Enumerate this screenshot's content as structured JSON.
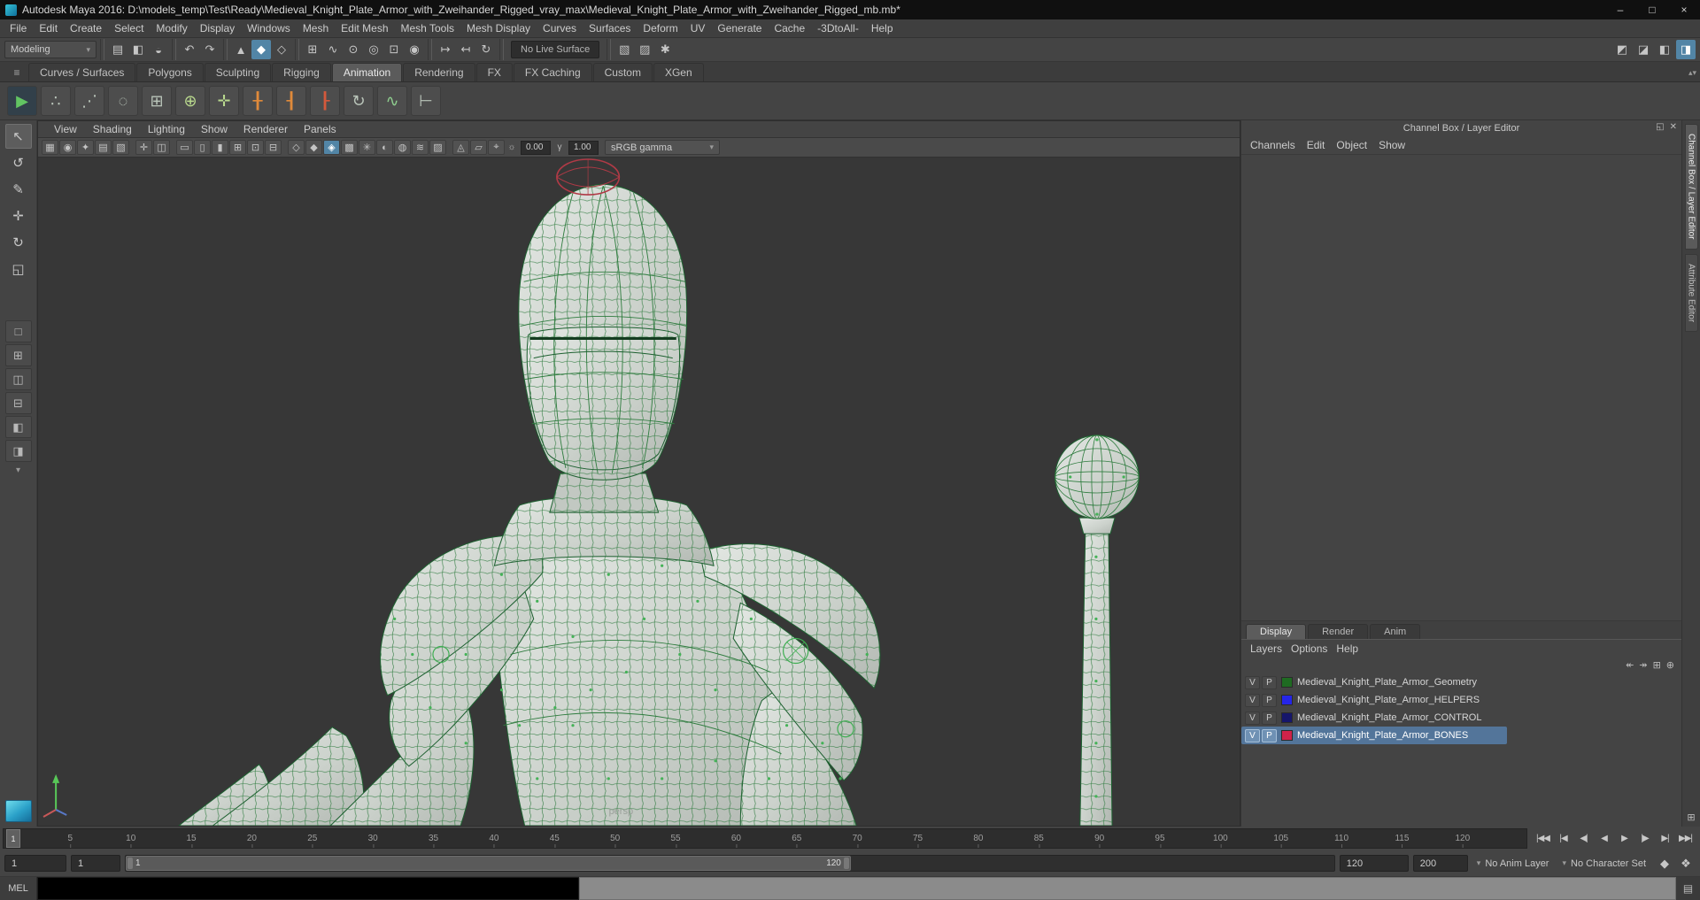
{
  "window": {
    "title": "Autodesk Maya 2016: D:\\models_temp\\Test\\Ready\\Medieval_Knight_Plate_Armor_with_Zweihander_Rigged_vray_max\\Medieval_Knight_Plate_Armor_with_Zweihander_Rigged_mb.mb*",
    "controls": [
      {
        "name": "minimize-button",
        "glyph": "–"
      },
      {
        "name": "maximize-button",
        "glyph": "□"
      },
      {
        "name": "close-button",
        "glyph": "×"
      }
    ]
  },
  "icons": {
    "caret_down": "▾",
    "shelf_menu": "≡",
    "shelf_scroll": "▴▾",
    "toolbox_more": "▾"
  },
  "menubar": {
    "items": [
      "File",
      "Edit",
      "Create",
      "Select",
      "Modify",
      "Display",
      "Windows",
      "Mesh",
      "Edit Mesh",
      "Mesh Tools",
      "Mesh Display",
      "Curves",
      "Surfaces",
      "Deform",
      "UV",
      "Generate",
      "Cache",
      "-3DtoAll-",
      "Help"
    ]
  },
  "statusline": {
    "menuset": "Modeling",
    "live_surface": "No Live Surface",
    "sections": [
      {
        "type": "icons",
        "icons": [
          {
            "name": "new-scene-icon",
            "glyph": "▤"
          },
          {
            "name": "open-scene-icon",
            "glyph": "◧"
          },
          {
            "name": "save-scene-icon",
            "glyph": "◒"
          }
        ]
      },
      {
        "type": "icons",
        "icons": [
          {
            "name": "undo-icon",
            "glyph": "↶"
          },
          {
            "name": "redo-icon",
            "glyph": "↷"
          }
        ]
      },
      {
        "type": "icons",
        "icons": [
          {
            "name": "select-hierarchy-icon",
            "glyph": "▲"
          },
          {
            "name": "select-object-icon",
            "glyph": "◆",
            "active": true
          },
          {
            "name": "select-component-icon",
            "glyph": "◇"
          }
        ]
      },
      {
        "type": "icons",
        "icons": [
          {
            "name": "snap-grid-icon",
            "glyph": "⊞"
          },
          {
            "name": "snap-curve-icon",
            "glyph": "∿"
          },
          {
            "name": "snap-point-icon",
            "glyph": "⊙"
          },
          {
            "name": "snap-projected-center-icon",
            "glyph": "◎"
          },
          {
            "name": "snap-view-plane-icon",
            "glyph": "⊡"
          },
          {
            "name": "make-live-icon",
            "glyph": "◉"
          }
        ]
      },
      {
        "type": "icons",
        "icons": [
          {
            "name": "input-connections-icon",
            "glyph": "↦"
          },
          {
            "name": "output-connections-icon",
            "glyph": "↤"
          },
          {
            "name": "construction-history-icon",
            "glyph": "↻"
          }
        ]
      },
      {
        "type": "field"
      },
      {
        "type": "icons",
        "icons": [
          {
            "name": "render-view-icon",
            "glyph": "▧"
          },
          {
            "name": "ipr-render-icon",
            "glyph": "▨"
          },
          {
            "name": "render-settings-icon",
            "glyph": "✱"
          }
        ]
      }
    ],
    "right_icons": [
      {
        "name": "sidebar-modeling-toolkit-icon",
        "glyph": "◩"
      },
      {
        "name": "sidebar-attribute-editor-icon",
        "glyph": "◪"
      },
      {
        "name": "sidebar-tool-settings-icon",
        "glyph": "◧"
      },
      {
        "name": "sidebar-channel-box-icon",
        "glyph": "◨",
        "active": true
      }
    ]
  },
  "shelf": {
    "tabs": [
      "Curves / Surfaces",
      "Polygons",
      "Sculpting",
      "Rigging",
      "Animation",
      "Rendering",
      "FX",
      "FX Caching",
      "Custom",
      "XGen"
    ],
    "active_tab": "Animation",
    "icons": [
      {
        "name": "playblast-icon",
        "glyph": "▶",
        "fg": "#62c462",
        "bg": "#32404a"
      },
      {
        "name": "set-key-icon",
        "glyph": "∴",
        "fg": "#b9c4b9",
        "bg": "#4d4d4d"
      },
      {
        "name": "set-breakdown-icon",
        "glyph": "⋰",
        "fg": "#b9c4b9",
        "bg": "#4d4d4d"
      },
      {
        "name": "motion-trail-icon",
        "glyph": "◌",
        "fg": "#b9c4b9",
        "bg": "#4d4d4d"
      },
      {
        "name": "ghost-icon",
        "glyph": "⊞",
        "fg": "#b9c4b9",
        "bg": "#4d4d4d"
      },
      {
        "name": "create-character-set-icon",
        "glyph": "⊕",
        "fg": "#b9d98e",
        "bg": "#4d4d4d"
      },
      {
        "name": "add-to-character-set-icon",
        "glyph": "✛",
        "fg": "#b9d98e",
        "bg": "#4d4d4d"
      },
      {
        "name": "point-constraint-icon",
        "glyph": "╂",
        "fg": "#e08a3a",
        "bg": "#4d4d4d"
      },
      {
        "name": "aim-constraint-icon",
        "glyph": "┨",
        "fg": "#e08a3a",
        "bg": "#4d4d4d"
      },
      {
        "name": "orient-constraint-icon",
        "glyph": "┠",
        "fg": "#d4593c",
        "bg": "#4d4d4d"
      },
      {
        "name": "set-driven-key-icon",
        "glyph": "↻",
        "fg": "#b9c4b9",
        "bg": "#4d4d4d"
      },
      {
        "name": "spline-ik-icon",
        "glyph": "∿",
        "fg": "#8fcf8f",
        "bg": "#4d4d4d"
      },
      {
        "name": "ik-handle-icon",
        "glyph": "⊢",
        "fg": "#b9c4b9",
        "bg": "#4d4d4d"
      }
    ]
  },
  "toolbox": {
    "tools": [
      {
        "name": "select-tool-icon",
        "glyph": "↖",
        "active": true
      },
      {
        "name": "lasso-tool-icon",
        "glyph": "↺"
      },
      {
        "name": "paint-select-tool-icon",
        "glyph": "✎"
      },
      {
        "name": "move-tool-icon",
        "glyph": "✛"
      },
      {
        "name": "rotate-tool-icon",
        "glyph": "↻"
      },
      {
        "name": "scale-tool-icon",
        "glyph": "◱"
      }
    ],
    "layouts": [
      {
        "name": "layout-single-pane-icon",
        "glyph": "□"
      },
      {
        "name": "layout-four-view-icon",
        "glyph": "⊞"
      },
      {
        "name": "layout-two-side-by-side-icon",
        "glyph": "◫"
      },
      {
        "name": "layout-two-stacked-icon",
        "glyph": "⊟"
      },
      {
        "name": "layout-three-split-icon",
        "glyph": "◧"
      },
      {
        "name": "layout-outliner-persp-icon",
        "glyph": "◨"
      }
    ]
  },
  "viewport": {
    "menus": [
      "View",
      "Shading",
      "Lighting",
      "Show",
      "Renderer",
      "Panels"
    ],
    "toolbar_icons": [
      {
        "name": "select-camera-icon",
        "glyph": "▦"
      },
      {
        "name": "lock-camera-icon",
        "glyph": "◉"
      },
      {
        "name": "camera-attributes-icon",
        "glyph": "✦"
      },
      {
        "name": "bookmarks-icon",
        "glyph": "▤"
      },
      {
        "name": "image-plane-icon",
        "glyph": "▧"
      },
      {
        "name": "two-d-pan-zoom-icon",
        "glyph": "✛"
      },
      {
        "name": "overscan-icon",
        "glyph": "◫"
      },
      {
        "name": "film-gate-icon",
        "glyph": "▭"
      },
      {
        "name": "resolution-gate-icon",
        "glyph": "▯"
      },
      {
        "name": "gate-mask-icon",
        "glyph": "▮"
      },
      {
        "name": "field-chart-icon",
        "glyph": "⊞"
      },
      {
        "name": "safe-action-icon",
        "glyph": "⊡"
      },
      {
        "name": "safe-title-icon",
        "glyph": "⊟"
      },
      {
        "name": "wireframe-icon",
        "glyph": "◇"
      },
      {
        "name": "shaded-icon",
        "glyph": "◆"
      },
      {
        "name": "wireframe-on-shaded-icon",
        "glyph": "◈",
        "active": true
      },
      {
        "name": "textured-icon",
        "glyph": "▩"
      },
      {
        "name": "use-all-lights-icon",
        "glyph": "✳"
      },
      {
        "name": "shadows-icon",
        "glyph": "◐"
      },
      {
        "name": "screen-ao-icon",
        "glyph": "◍"
      },
      {
        "name": "motion-blur-icon",
        "glyph": "≋"
      },
      {
        "name": "multisample-icon",
        "glyph": "▨"
      },
      {
        "name": "isolate-select-icon",
        "glyph": "◬"
      },
      {
        "name": "xray-icon",
        "glyph": "▱"
      },
      {
        "name": "xray-joints-icon",
        "glyph": "⌖"
      }
    ],
    "exposure_icon_glyph": "☼",
    "gamma_icon_glyph": "γ",
    "exposure_label": "0.00",
    "gamma_label": "1.00",
    "view_transform": "sRGB gamma",
    "camera_label": "persp"
  },
  "channel_box": {
    "header": "Channel Box / Layer Editor",
    "header_icons": [
      {
        "name": "float-panel-icon",
        "glyph": "◱"
      },
      {
        "name": "close-panel-icon",
        "glyph": "✕"
      }
    ],
    "menus": [
      "Channels",
      "Edit",
      "Object",
      "Show"
    ]
  },
  "layer_editor": {
    "tabs": [
      {
        "label": "Display",
        "active": true
      },
      {
        "label": "Render",
        "active": false
      },
      {
        "label": "Anim",
        "active": false
      }
    ],
    "menus": [
      "Layers",
      "Options",
      "Help"
    ],
    "toolbar_icons": [
      {
        "name": "move-layer-up-icon",
        "glyph": "↞"
      },
      {
        "name": "move-layer-down-icon",
        "glyph": "↠"
      },
      {
        "name": "new-empty-layer-icon",
        "glyph": "⊞"
      },
      {
        "name": "new-layer-from-selected-icon",
        "glyph": "⊕"
      }
    ],
    "layers": [
      {
        "visible": "V",
        "playback": "P",
        "color": "#1f6b22",
        "name": "Medieval_Knight_Plate_Armor_Geometry",
        "selected": false
      },
      {
        "visible": "V",
        "playback": "P",
        "color": "#2525e8",
        "name": "Medieval_Knight_Plate_Armor_HELPERS",
        "selected": false
      },
      {
        "visible": "V",
        "playback": "P",
        "color": "#16166b",
        "name": "Medieval_Knight_Plate_Armor_CONTROL",
        "selected": false
      },
      {
        "visible": "V",
        "playback": "P",
        "color": "#d0224a",
        "name": "Medieval_Knight_Plate_Armor_BONES",
        "selected": true
      }
    ]
  },
  "sidebar": {
    "tabs": [
      {
        "label": "Channel Box / Layer Editor",
        "active": true
      },
      {
        "label": "Attribute Editor",
        "active": false
      }
    ],
    "bottom_icon": {
      "name": "raise-panel-icon",
      "glyph": "⊞"
    }
  },
  "timeline": {
    "current_frame": "1",
    "ticks": [
      5,
      10,
      15,
      20,
      25,
      30,
      35,
      40,
      45,
      50,
      55,
      60,
      65,
      70,
      75,
      80,
      85,
      90,
      95,
      100,
      105,
      110,
      115,
      120
    ],
    "playback": [
      {
        "name": "go-to-start-button",
        "glyph": "|◀◀"
      },
      {
        "name": "step-back-frame-button",
        "glyph": "|◀"
      },
      {
        "name": "step-back-key-button",
        "glyph": "◀|"
      },
      {
        "name": "play-backwards-button",
        "glyph": "◀"
      },
      {
        "name": "play-forwards-button",
        "glyph": "▶"
      },
      {
        "name": "step-forward-key-button",
        "glyph": "|▶"
      },
      {
        "name": "step-forward-frame-button",
        "glyph": "▶|"
      },
      {
        "name": "go-to-end-button",
        "glyph": "▶▶|"
      }
    ]
  },
  "range_slider": {
    "fields": {
      "anim_start": "1",
      "playback_start": "1",
      "playback_end": "120",
      "anim_end": "200"
    },
    "bar_start_label": "1",
    "bar_end_label": "120",
    "anim_layer": "No Anim Layer",
    "character_set": "No Character Set",
    "icons": [
      {
        "name": "auto-keyframe-icon",
        "glyph": "◆"
      },
      {
        "name": "anim-preferences-icon",
        "glyph": "❖"
      }
    ]
  },
  "command_line": {
    "label": "MEL",
    "input_value": "",
    "results_value": "",
    "script_editor_icon": {
      "name": "script-editor-icon",
      "glyph": "▤"
    }
  },
  "colors": {
    "accent_blue": "#5285a6",
    "selection_row_blue": "#53759a",
    "viewport_bg": "#373737",
    "wireframe_green": "#2e7c3e",
    "control_circle_red": "#b03a46"
  }
}
